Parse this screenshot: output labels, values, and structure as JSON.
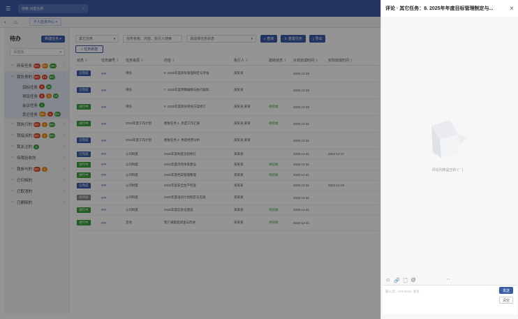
{
  "topbar": {
    "menu_icon": "☰",
    "search_placeholder": "搜索 功能名称",
    "search_icon": "⌕"
  },
  "tabbar": {
    "back_icon": "‹",
    "home_icon": "⌂",
    "tab_label": "个人任务中心 ×"
  },
  "sidebar": {
    "title": "待办",
    "new_button": "新建任务",
    "select_value": "请选择",
    "items": [
      {
        "label": "所有任务",
        "badges": [
          [
            "99+",
            "red"
          ],
          [
            "99+",
            "orange"
          ],
          [
            "99+",
            "green"
          ]
        ],
        "active": false,
        "sub": false
      },
      {
        "label": "我负责的",
        "badges": [
          [
            "99+",
            "red"
          ],
          [
            "24",
            "red"
          ],
          [
            "99+",
            "green"
          ]
        ],
        "active": true,
        "sub": false
      },
      {
        "label": "目标任务",
        "badges": [
          [
            "3",
            "red"
          ],
          [
            "28",
            "green"
          ]
        ],
        "active": true,
        "sub": true
      },
      {
        "label": "项目任务",
        "badges": [
          [
            "5",
            "red"
          ],
          [
            "3",
            "orange"
          ],
          [
            "16",
            "green"
          ]
        ],
        "active": true,
        "sub": true
      },
      {
        "label": "会议任务",
        "badges": [
          [
            "1",
            "green"
          ]
        ],
        "active": true,
        "sub": true
      },
      {
        "label": "其它任务",
        "badges": [
          [
            "99+",
            "orange"
          ],
          [
            "3",
            "red"
          ],
          [
            "99+",
            "green"
          ]
        ],
        "active": true,
        "sub": true
      },
      {
        "label": "我执行的",
        "badges": [
          [
            "99+",
            "red"
          ],
          [
            "3",
            "orange"
          ],
          [
            "99+",
            "green"
          ]
        ],
        "active": false,
        "sub": false
      },
      {
        "label": "我指派的",
        "badges": [
          [
            "99+",
            "red"
          ],
          [
            "3",
            "orange"
          ],
          [
            "99+",
            "green"
          ]
        ],
        "active": false,
        "sub": false
      },
      {
        "label": "我关注的",
        "badges": [
          [
            "5",
            "green"
          ]
        ],
        "active": false,
        "sub": false
      },
      {
        "label": "待我验收的",
        "badges": [],
        "active": false,
        "sub": false
      },
      {
        "label": "我参与的",
        "badges": [
          [
            "99+",
            "red"
          ],
          [
            "3",
            "orange"
          ]
        ],
        "active": false,
        "sub": false
      },
      {
        "label": "已归档的",
        "badges": [],
        "active": false,
        "sub": false
      },
      {
        "label": "已取消的",
        "badges": [],
        "active": false,
        "sub": false
      },
      {
        "label": "已删除的",
        "badges": [],
        "active": false,
        "sub": false
      }
    ]
  },
  "filters": {
    "type_select": "其它任务",
    "keyword_placeholder": "任务名称、内容、执行人搜索",
    "status_select": "请选择任务状态",
    "search_button": "查询",
    "reset_button": "重置任务",
    "export_button": "导出",
    "add_button": "+ 任务新建"
  },
  "table": {
    "headers": [
      "状态",
      "任务编号",
      "任务来源",
      "内容",
      "执行人",
      "验收状态",
      "计划完成时间",
      "实际完成时间"
    ],
    "rows": [
      {
        "status": "已完成",
        "color": "blue",
        "id": "###",
        "source": "目标",
        "content": "8. 2025年度目标管理制定与考核",
        "owner": "某某某",
        "check": "",
        "plan": "2025-12-30",
        "actual": ""
      },
      {
        "status": "已完成",
        "color": "blue",
        "id": "###",
        "source": "目标",
        "content": "7. 2025年度预算编制与执行跟踪",
        "owner": "某某某",
        "check": "",
        "plan": "2025-12-30",
        "actual": ""
      },
      {
        "status": "进行中",
        "color": "green",
        "id": "###",
        "source": "目标",
        "content": "6. 2025年度绩效考核方案修订",
        "owner": "某某某,某某",
        "check": "待验收",
        "plan": "2025-12-30",
        "actual": ""
      },
      {
        "status": "进行中",
        "color": "green",
        "id": "###",
        "source": "2025年度工作计划",
        "content": "模板任务 1. 月度工作汇报",
        "owner": "某某某,某某",
        "check": "待验收",
        "plan": "2025-12-31",
        "actual": ""
      },
      {
        "status": "已完成",
        "color": "blue",
        "id": "###",
        "source": "2025年度工作计划",
        "content": "模板任务 2. 季度经营分析",
        "owner": "某某某,某某",
        "check": "",
        "plan": "2025-12-31",
        "actual": ""
      },
      {
        "status": "已完成",
        "color": "blue",
        "id": "###",
        "source": "公司制度",
        "content": "2025年度制度流程修订",
        "owner": "某某某",
        "check": "",
        "plan": "2025-12-31",
        "actual": "2024-12-27"
      },
      {
        "status": "进行中",
        "color": "green",
        "id": "###",
        "source": "公司制度",
        "content": "2025年度内控体系建设",
        "owner": "某某某",
        "check": "待验收",
        "plan": "2025-12-31",
        "actual": ""
      },
      {
        "status": "进行中",
        "color": "green",
        "id": "###",
        "source": "公司制度",
        "content": "2025年度档案管理整理",
        "owner": "某某某",
        "check": "待验收",
        "plan": "2025-12-31",
        "actual": ""
      },
      {
        "status": "已完成",
        "color": "blue",
        "id": "###",
        "source": "公司制度",
        "content": "2025年度安全生产检查",
        "owner": "某某某",
        "check": "",
        "plan": "2025-12-31",
        "actual": "2024-12-26"
      },
      {
        "status": "待开始",
        "color": "grey",
        "id": "###",
        "source": "公司制度",
        "content": "2025年度培训计划制定与实施",
        "owner": "某某某",
        "check": "",
        "plan": "2025-12-31",
        "actual": ""
      },
      {
        "status": "进行中",
        "color": "green",
        "id": "###",
        "source": "公司制度",
        "content": "2025年度信息化建设",
        "owner": "某某某",
        "check": "待验收",
        "plan": "2025-12-31",
        "actual": ""
      },
      {
        "status": "进行中",
        "color": "green",
        "id": "###",
        "source": "其他",
        "content": "客户满意度调查与改进",
        "owner": "某某某",
        "check": "待验收",
        "plan": "2025-12-31",
        "actual": ""
      }
    ]
  },
  "drawer": {
    "title": "评论 · 其它任务：8. 2025年年度目标管理制定与...",
    "close_icon": "×",
    "empty_text": "评论列表是空的 (' ' )",
    "handle": "︿",
    "tools": [
      "☺",
      "🔗",
      "🗋",
      "@"
    ],
    "placeholder": "输入后，Ctrl+Enter 发送",
    "send_button": "发送",
    "clear_button": "清空"
  }
}
